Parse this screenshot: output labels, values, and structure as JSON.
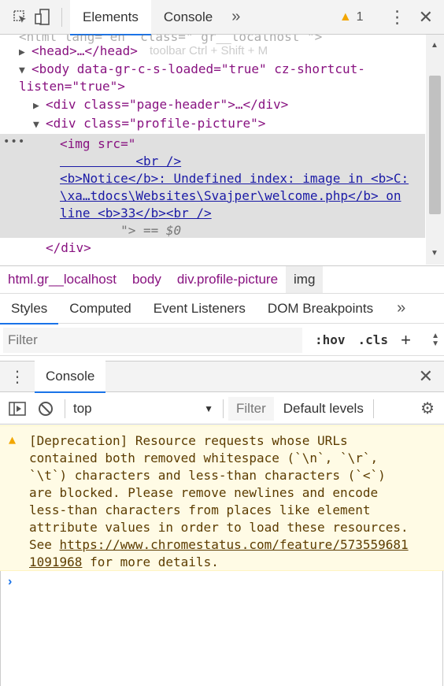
{
  "toolbar": {
    "tabs": [
      "Elements",
      "Console"
    ],
    "more_tabs": "»",
    "warnings_count": "1"
  },
  "tree": {
    "line0": "<html lang=\"en\" class=\" gr__localhost \">",
    "head": "<head>…</head>",
    "body_open": "<body data-gr-c-s-loaded=\"true\" cz-shortcut-",
    "body_open_2": "listen=\"true\">",
    "page_header": "<div class=\"page-header\">…</div>",
    "profile_picture": "<div class=\"profile-picture\">",
    "img_src": "<img src=\"",
    "img_l1": "          <br />",
    "img_l2": "<b>Notice</b>:  Undefined index: image in <b>C:",
    "img_l3": "\\xa…tdocs\\Websites\\Svajper\\welcome.php</b> on",
    "img_l4": "line <b>33</b><br />",
    "img_l5": "        \"> == $0",
    "div_close": "</div>",
    "ghost_hint": "toolbar  Ctrl + Shift + M"
  },
  "breadcrumbs": [
    "html.gr__localhost",
    "body",
    "div.profile-picture",
    "img"
  ],
  "styles": {
    "tabs": [
      "Styles",
      "Computed",
      "Event Listeners",
      "DOM Breakpoints"
    ],
    "more": "»",
    "filter_placeholder": "Filter",
    "hov": ":hov",
    "cls": ".cls",
    "plus": "+"
  },
  "drawer": {
    "tab": "Console",
    "context": "top",
    "filter_placeholder": "Filter",
    "levels": "Default levels"
  },
  "message": {
    "lines": [
      "[Deprecation] Resource requests whose URLs",
      "contained both removed whitespace (`\\n`, `\\r`,",
      "`\\t`) characters and less-than characters (`<`)",
      "are blocked. Please remove newlines and encode",
      "less-than characters from places like element",
      "attribute values in order to load these resources."
    ],
    "see": "See ",
    "link_part1": "https://www.chromestatus.com/feature/573559681",
    "link_part2": "1091968",
    "tail": " for more details."
  },
  "prompt": "›"
}
